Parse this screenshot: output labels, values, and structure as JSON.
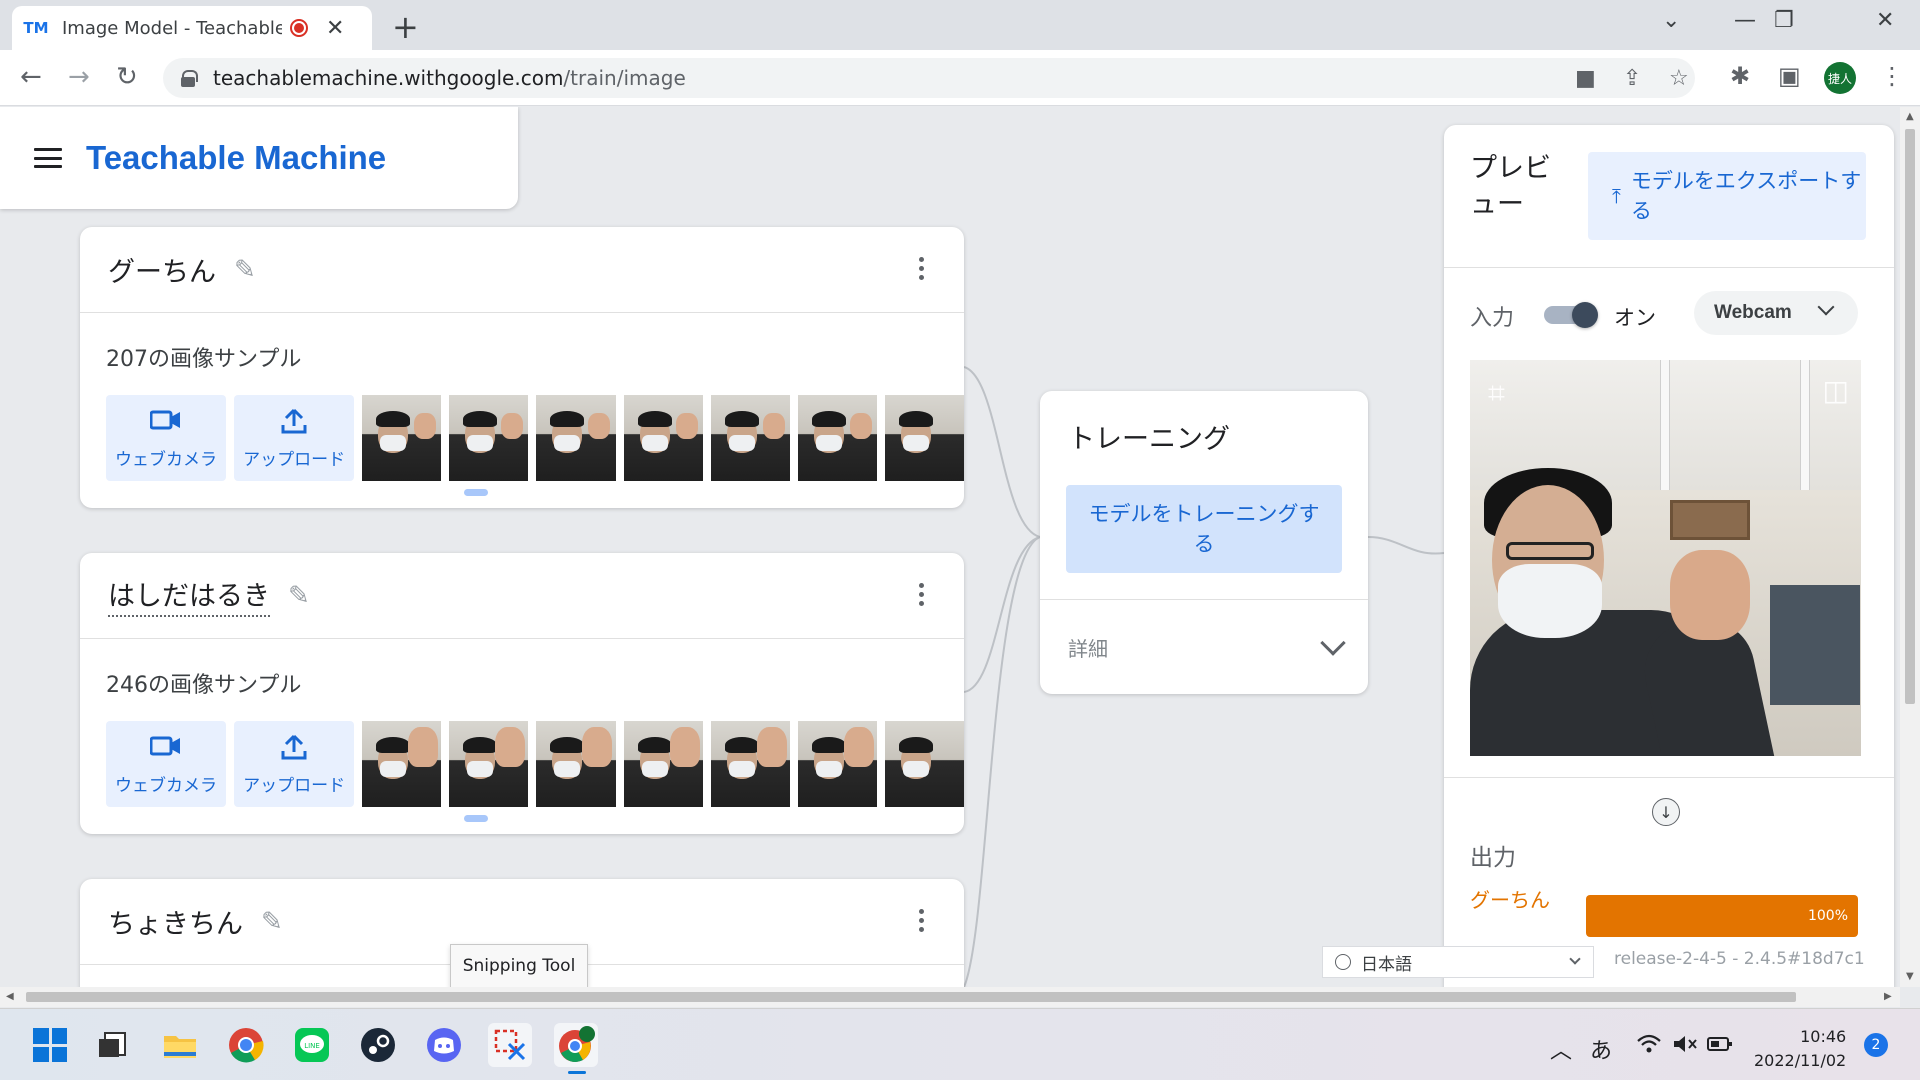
{
  "browser": {
    "tab_title": "Image Model - Teachable Ma",
    "tab_favicon": "TM",
    "url_host": "teachablemachine.withgoogle.com",
    "url_path": "/train/image",
    "profile_initials": "捷人"
  },
  "app": {
    "brand": "Teachable Machine"
  },
  "classes": [
    {
      "name": "グーちん",
      "sample_count": "207の画像サンプル",
      "webcam_label": "ウェブカメラ",
      "upload_label": "アップロード"
    },
    {
      "name": "はしだはるき",
      "sample_count": "246の画像サンプル",
      "webcam_label": "ウェブカメラ",
      "upload_label": "アップロード"
    },
    {
      "name": "ちょきちん"
    }
  ],
  "training": {
    "title": "トレーニング",
    "train_button": "モデルをトレーニングする",
    "advanced_label": "詳細"
  },
  "preview": {
    "title": "プレビュー",
    "export_button": "モデルをエクスポートする",
    "input_label": "入力",
    "toggle_state": "オン",
    "source": "Webcam",
    "output_label": "出力",
    "outputs": [
      {
        "class": "グーちん",
        "percent_label": "100%",
        "value": 100,
        "color": "#e37400"
      }
    ]
  },
  "footer": {
    "language": "日本語",
    "version": "release-2-4-5 - 2.4.5#18d7c1"
  },
  "tooltip": "Snipping Tool",
  "taskbar": {
    "ime": "あ",
    "time": "10:46",
    "date": "2022/11/02",
    "notifications": "2",
    "chrome_badge": "捷人"
  }
}
